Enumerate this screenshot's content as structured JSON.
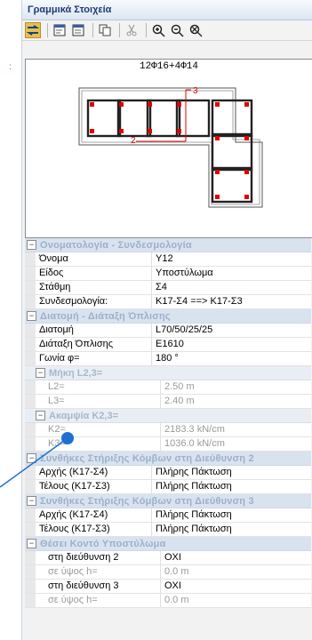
{
  "panel": {
    "title": "Γραμμικά Στοιχεία"
  },
  "toolbar": {
    "buttons": [
      {
        "icon": "swap-icon"
      },
      {
        "icon": "properties-icon"
      },
      {
        "icon": "properties-alt-icon"
      },
      {
        "icon": "copy-icon"
      },
      {
        "icon": "cut-icon"
      },
      {
        "icon": "zoom-in-icon"
      },
      {
        "icon": "zoom-out-icon"
      },
      {
        "icon": "zoom-fit-icon"
      }
    ]
  },
  "section": {
    "reinforcement_label": "12Φ16+4Φ14",
    "axis3": "3",
    "axis2": "2"
  },
  "grid": {
    "cat_naming": "Ονοματολογία - Συνδεσμολογία",
    "name_label": "Όνομα",
    "name_val": "Y12",
    "type_label": "Είδος",
    "type_val": "Υποστύλωμα",
    "level_label": "Στάθμη",
    "level_val": "Σ4",
    "conn_label": "Συνδεσμολογία:",
    "conn_val": "K17-Σ4 ==> K17-Σ3",
    "cat_section": "Διατομή - Διάταξη Όπλισης",
    "sec_label": "Διατομή",
    "sec_val": "L70/50/25/25",
    "reinf_label": "Διάταξη Όπλισης",
    "reinf_val": "E1610",
    "angle_label": "Γωνία φ=",
    "angle_val": "180 °",
    "subcat_lengths": "Μήκη L2,3=",
    "l2_label": "L2=",
    "l2_val": "2.50 m",
    "l3_label": "L3=",
    "l3_val": "2.40 m",
    "subcat_stiff": "Ακαμψία K2,3=",
    "k2_label": "K2=",
    "k2_val": "2183.3 kN/cm",
    "k3_label": "K3=",
    "k3_val": "1036.0 kN/cm",
    "cat_support2": "Συνθήκες Στήριξης Κόμβων στη Διεύθυνση 2",
    "s2_start_label": "Αρχής (K17-Σ4)",
    "s2_start_val": "Πλήρης Πάκτωση",
    "s2_end_label": "Τέλους (K17-Σ3)",
    "s2_end_val": "Πλήρης Πάκτωση",
    "cat_support3": "Συνθήκες Στήριξης Κόμβων στη Διεύθυνση 3",
    "s3_start_label": "Αρχής (K17-Σ4)",
    "s3_start_val": "Πλήρης Πάκτωση",
    "s3_end_label": "Τέλους (K17-Σ3)",
    "s3_end_val": "Πλήρης Πάκτωση",
    "cat_short": "Θέσει Κοντό Υποστύλωμα",
    "dir2_label": "στη διεύθυνση 2",
    "dir2_val": "OXI",
    "h2_label": "σε ύψος h=",
    "h2_val": "0.0 m",
    "dir3_label": "στη διεύθυνση 3",
    "dir3_val": "OXI",
    "h3_label": "σε ύψος h=",
    "h3_val": "0.0 m"
  },
  "colors": {
    "accent": "#1f6fd1",
    "rebar": "#e00000",
    "header_bg": "#d9e3f0"
  }
}
